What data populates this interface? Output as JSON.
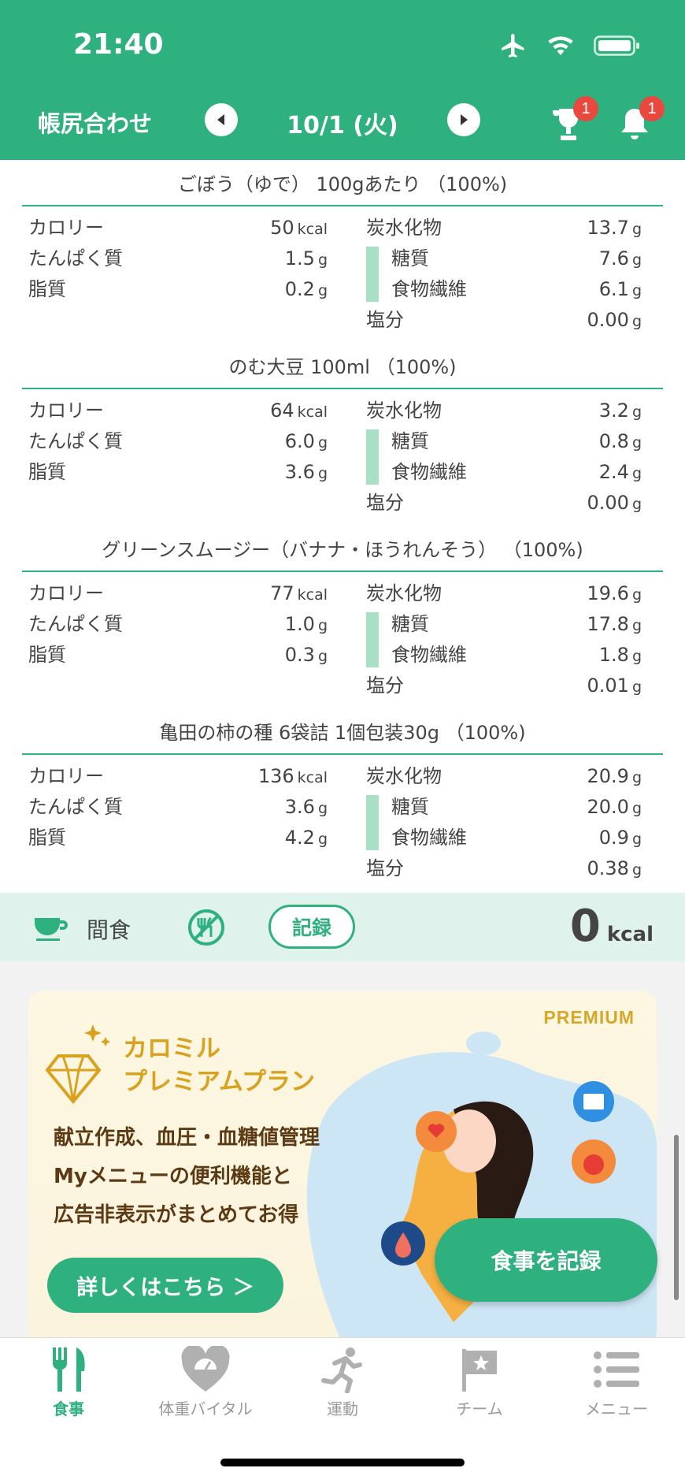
{
  "status": {
    "time": "21:40"
  },
  "header": {
    "title": "帳尻合わせ",
    "date": "10/1 (火)",
    "trophy_badge": "1",
    "bell_badge": "1"
  },
  "colors": {
    "brand": "#2fb07f",
    "accent_gold": "#d6a82a",
    "badge": "#e8483d"
  },
  "foods": [
    {
      "title": "ごぼう（ゆで） 100gあたり （100%)",
      "calorie": "50",
      "protein": "1.5",
      "fat": "0.2",
      "carbs": "13.7",
      "sugar": "7.6",
      "fiber": "6.1",
      "salt": "0.00"
    },
    {
      "title": "のむ大豆 100ml （100%)",
      "calorie": "64",
      "protein": "6.0",
      "fat": "3.6",
      "carbs": "3.2",
      "sugar": "0.8",
      "fiber": "2.4",
      "salt": "0.00"
    },
    {
      "title": "グリーンスムージー（バナナ・ほうれんそう） （100%)",
      "calorie": "77",
      "protein": "1.0",
      "fat": "0.3",
      "carbs": "19.6",
      "sugar": "17.8",
      "fiber": "1.8",
      "salt": "0.01"
    },
    {
      "title": "亀田の柿の種 6袋詰 1個包装30g （100%)",
      "calorie": "136",
      "protein": "3.6",
      "fat": "4.2",
      "carbs": "20.9",
      "sugar": "20.0",
      "fiber": "0.9",
      "salt": "0.38"
    }
  ],
  "labels": {
    "calorie": "カロリー",
    "protein": "たんぱく質",
    "fat": "脂質",
    "carbs": "炭水化物",
    "sugar": "糖質",
    "fiber": "食物繊維",
    "salt": "塩分",
    "kcal": "kcal",
    "g": "g"
  },
  "snack": {
    "label": "間食",
    "record": "記録",
    "kcal_value": "0",
    "kcal_unit": "kcal"
  },
  "banner": {
    "premium": "PREMIUM",
    "title_line1": "カロミル",
    "title_line2": "プレミアムプラン",
    "desc_line1": "献立作成、血圧・血糖値管理",
    "desc_line2": "Myメニューの便利機能と",
    "desc_line3": "広告非表示がまとめてお得",
    "detail_button": "詳しくはこちら ＞"
  },
  "fab_label": "食事を記録",
  "tabs": [
    {
      "label": "食事",
      "icon": "fork-knife-icon",
      "active": true
    },
    {
      "label": "体重バイタル",
      "icon": "heart-scale-icon",
      "active": false
    },
    {
      "label": "運動",
      "icon": "runner-icon",
      "active": false
    },
    {
      "label": "チーム",
      "icon": "flag-icon",
      "active": false
    },
    {
      "label": "メニュー",
      "icon": "menu-list-icon",
      "active": false
    }
  ]
}
